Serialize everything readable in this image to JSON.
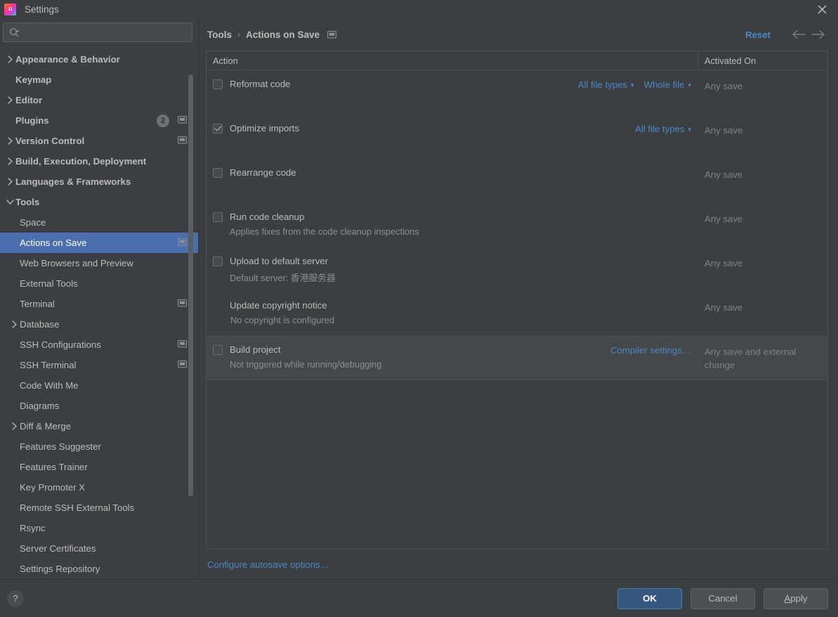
{
  "window": {
    "title": "Settings",
    "logo_text": "IJ",
    "close_icon": "close-icon"
  },
  "sidebar": {
    "search": {
      "value": "",
      "placeholder": "",
      "icon": "search-icon"
    },
    "items": [
      {
        "label": "Appearance & Behavior",
        "level": 0,
        "arrow": "right",
        "bold": true
      },
      {
        "label": "Keymap",
        "level": 0,
        "arrow": "none",
        "bold": true
      },
      {
        "label": "Editor",
        "level": 0,
        "arrow": "right",
        "bold": true
      },
      {
        "label": "Plugins",
        "level": 0,
        "arrow": "none",
        "bold": true,
        "badge": "2",
        "monitor": true
      },
      {
        "label": "Version Control",
        "level": 0,
        "arrow": "right",
        "bold": true,
        "monitor": true
      },
      {
        "label": "Build, Execution, Deployment",
        "level": 0,
        "arrow": "right",
        "bold": true
      },
      {
        "label": "Languages & Frameworks",
        "level": 0,
        "arrow": "right",
        "bold": true
      },
      {
        "label": "Tools",
        "level": 0,
        "arrow": "down",
        "bold": true
      },
      {
        "label": "Space",
        "level": 1,
        "arrow": "none"
      },
      {
        "label": "Actions on Save",
        "level": 1,
        "arrow": "none",
        "selected": true,
        "monitor": true
      },
      {
        "label": "Web Browsers and Preview",
        "level": 1,
        "arrow": "none"
      },
      {
        "label": "External Tools",
        "level": 1,
        "arrow": "none"
      },
      {
        "label": "Terminal",
        "level": 1,
        "arrow": "none",
        "monitor": true
      },
      {
        "label": "Database",
        "level": 1,
        "arrow": "right"
      },
      {
        "label": "SSH Configurations",
        "level": 1,
        "arrow": "none",
        "monitor": true
      },
      {
        "label": "SSH Terminal",
        "level": 1,
        "arrow": "none",
        "monitor": true
      },
      {
        "label": "Code With Me",
        "level": 1,
        "arrow": "none"
      },
      {
        "label": "Diagrams",
        "level": 1,
        "arrow": "none"
      },
      {
        "label": "Diff & Merge",
        "level": 1,
        "arrow": "right"
      },
      {
        "label": "Features Suggester",
        "level": 1,
        "arrow": "none"
      },
      {
        "label": "Features Trainer",
        "level": 1,
        "arrow": "none"
      },
      {
        "label": "Key Promoter X",
        "level": 1,
        "arrow": "none"
      },
      {
        "label": "Remote SSH External Tools",
        "level": 1,
        "arrow": "none"
      },
      {
        "label": "Rsync",
        "level": 1,
        "arrow": "none"
      },
      {
        "label": "Server Certificates",
        "level": 1,
        "arrow": "none"
      },
      {
        "label": "Settings Repository",
        "level": 1,
        "arrow": "none"
      }
    ]
  },
  "header": {
    "breadcrumb_root": "Tools",
    "breadcrumb_sep": "›",
    "breadcrumb_current": "Actions on Save",
    "breadcrumb_icon": "monitor-icon",
    "reset_label": "Reset",
    "back_icon": "arrow-left-icon",
    "forward_icon": "arrow-right-icon"
  },
  "table": {
    "columns": {
      "action": "Action",
      "activated": "Activated On"
    },
    "rows": [
      {
        "name": "reformat-code",
        "label": "Reformat code",
        "sub": "",
        "checkbox": "unchecked",
        "options": [
          "All file types",
          "Whole file"
        ],
        "activated": "Any save",
        "highlight": false
      },
      {
        "name": "optimize-imports",
        "label": "Optimize imports",
        "sub": "",
        "checkbox": "checked",
        "options": [
          "All file types"
        ],
        "activated": "Any save",
        "highlight": false
      },
      {
        "name": "rearrange-code",
        "label": "Rearrange code",
        "sub": "",
        "checkbox": "unchecked",
        "options": [],
        "activated": "Any save",
        "highlight": false
      },
      {
        "name": "run-code-cleanup",
        "label": "Run code cleanup",
        "sub": "Applies fixes from the code cleanup inspections",
        "checkbox": "unchecked",
        "options": [],
        "activated": "Any save",
        "highlight": false
      },
      {
        "name": "upload-to-default-server",
        "label": "Upload to default server",
        "sub": "Default server: 香港服务器",
        "checkbox": "unchecked",
        "options": [],
        "activated": "Any save",
        "highlight": false
      },
      {
        "name": "update-copyright-notice",
        "label": "Update copyright notice",
        "sub": "No copyright is configured",
        "checkbox": "none",
        "options": [],
        "activated": "Any save",
        "highlight": false
      },
      {
        "name": "build-project",
        "label": "Build project",
        "sub": "Not triggered while running/debugging",
        "checkbox": "unchecked",
        "options": [
          "Compiler settings…"
        ],
        "options_no_caret": true,
        "activated": "Any save and external change",
        "highlight": true
      }
    ]
  },
  "footer": {
    "autosave_link": "Configure autosave options…",
    "help_label": "?",
    "ok_label": "OK",
    "cancel_label": "Cancel",
    "apply_mnemonic": "A",
    "apply_rest": "pply"
  },
  "colors": {
    "accent_link": "#4a88c7",
    "selection": "#4b6eaf",
    "primary_button": "#365880",
    "background": "#3c3f41",
    "text": "#bbbbbb",
    "muted_text": "#7f8284"
  }
}
